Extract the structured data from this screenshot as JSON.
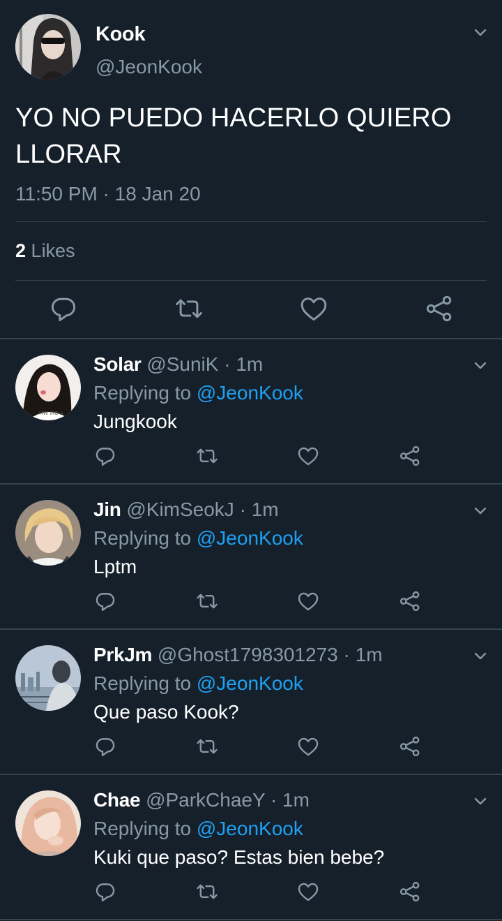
{
  "main_tweet": {
    "name": "Kook",
    "handle": "@JeonKook",
    "text": "YO NO PUEDO HACERLO QUIERO LLORAR",
    "timestamp": "11:50 PM · 18 Jan 20",
    "likes_count": "2",
    "likes_label": "Likes"
  },
  "replies": [
    {
      "name": "Solar",
      "handle": "@SuniK",
      "time": "· 1m",
      "replying_prefix": "Replying to",
      "replying_to": "@JeonKook",
      "text": "Jungkook"
    },
    {
      "name": "Jin",
      "handle": "@KimSeokJ",
      "time": "· 1m",
      "replying_prefix": "Replying to",
      "replying_to": "@JeonKook",
      "text": "Lptm"
    },
    {
      "name": "PrkJm",
      "handle": "@Ghost1798301273",
      "time": "· 1m",
      "replying_prefix": "Replying to",
      "replying_to": "@JeonKook",
      "text": "Que paso Kook?"
    },
    {
      "name": "Chae",
      "handle": "@ParkChaeY",
      "time": "· 1m",
      "replying_prefix": "Replying to",
      "replying_to": "@JeonKook",
      "text": "Kuki que paso? Estas bien bebe?"
    }
  ],
  "icons": {
    "reply": "reply-icon",
    "retweet": "retweet-icon",
    "like": "heart-icon",
    "share": "share-icon",
    "more": "chevron-down-icon"
  },
  "colors": {
    "background": "#15202b",
    "divider": "#38444d",
    "secondary_text": "#8899a6",
    "accent": "#1da1f2"
  }
}
